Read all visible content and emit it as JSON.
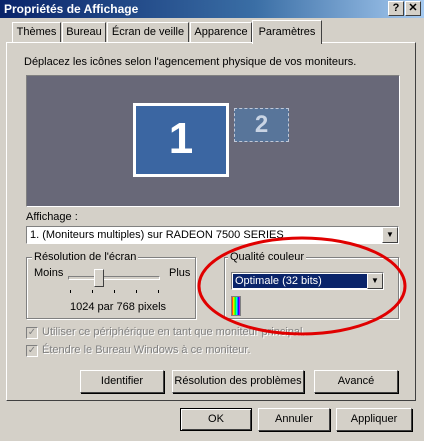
{
  "window": {
    "title": "Propriétés de Affichage",
    "help_button": "?",
    "close_button": "✕"
  },
  "tabs": [
    {
      "label": "Thèmes"
    },
    {
      "label": "Bureau"
    },
    {
      "label": "Écran de veille"
    },
    {
      "label": "Apparence"
    },
    {
      "label": "Paramètres",
      "active": true
    }
  ],
  "settings": {
    "instruction": "Déplacez les icônes selon l'agencement physique de vos moniteurs.",
    "monitors": [
      {
        "number": "1",
        "primary": true
      },
      {
        "number": "2",
        "primary": false
      }
    ],
    "display": {
      "label": "Affichage :",
      "value": "1. (Moniteurs multiples) sur RADEON 7500 SERIES"
    },
    "resolution": {
      "group_title": "Résolution de l'écran",
      "less_label": "Moins",
      "more_label": "Plus",
      "value_text": "1024 par 768 pixels",
      "slider_position": 0.3
    },
    "color_quality": {
      "group_title": "Qualité couleur",
      "selected": "Optimale (32 bits)"
    },
    "checkboxes": [
      {
        "label": "Utiliser ce périphérique en tant que moniteur principal.",
        "checked": true,
        "enabled": false
      },
      {
        "label": "Étendre le Bureau Windows à ce moniteur.",
        "checked": true,
        "enabled": false
      }
    ],
    "buttons": {
      "identify": "Identifier",
      "troubleshoot": "Résolution des problèmes",
      "advanced": "Avancé"
    }
  },
  "dialog_buttons": {
    "ok": "OK",
    "cancel": "Annuler",
    "apply": "Appliquer"
  },
  "annotation": {
    "color": "#e00000",
    "shape": "ellipse"
  },
  "colors": {
    "titlebar": "#0a246a",
    "preview_bg": "#686878",
    "monitor_primary": "#3b66a2",
    "selection": "#0a246a"
  }
}
